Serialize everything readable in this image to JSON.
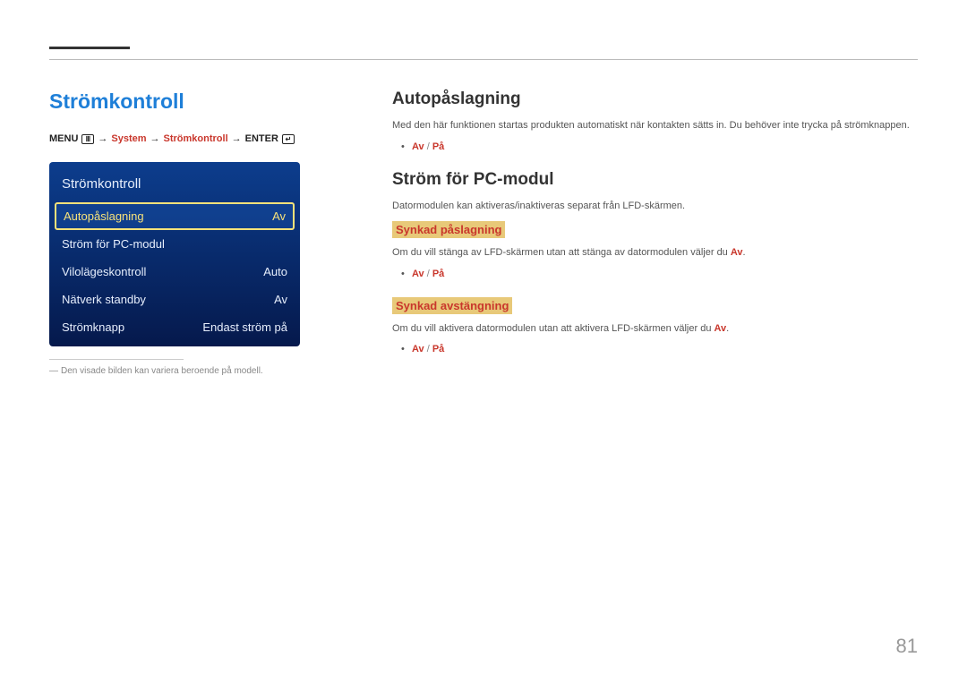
{
  "page_number": "81",
  "left": {
    "title": "Strömkontroll",
    "breadcrumb": {
      "menu": "MENU",
      "arrow": "→",
      "system": "System",
      "stromkontroll": "Strömkontroll",
      "enter": "ENTER"
    },
    "menu": {
      "title": "Strömkontroll",
      "rows": [
        {
          "label": "Autopåslagning",
          "value": "Av"
        },
        {
          "label": "Ström för PC-modul",
          "value": ""
        },
        {
          "label": "Vilolägeskontroll",
          "value": "Auto"
        },
        {
          "label": "Nätverk standby",
          "value": "Av"
        },
        {
          "label": "Strömknapp",
          "value": "Endast ström på"
        }
      ]
    },
    "footnote_dash": "―",
    "footnote": "Den visade bilden kan variera beroende på modell."
  },
  "right": {
    "section1": {
      "heading": "Autopåslagning",
      "text": "Med den här funktionen startas produkten automatiskt när kontakten sätts in. Du behöver inte trycka på strömknappen.",
      "options_av": "Av",
      "options_sep": " / ",
      "options_pa": "På"
    },
    "section2": {
      "heading": "Ström för PC-modul",
      "text": "Datormodulen kan aktiveras/inaktiveras separat från LFD-skärmen.",
      "sub1": {
        "heading": "Synkad påslagning",
        "text_pre": "Om du vill stänga av LFD-skärmen utan att stänga av datormodulen väljer du ",
        "text_av": "Av",
        "text_post": ".",
        "options_av": "Av",
        "options_sep": " / ",
        "options_pa": "På"
      },
      "sub2": {
        "heading": "Synkad avstängning",
        "text_pre": "Om du vill aktivera datormodulen utan att aktivera LFD-skärmen väljer du ",
        "text_av": "Av",
        "text_post": ".",
        "options_av": "Av",
        "options_sep": " / ",
        "options_pa": "På"
      }
    }
  }
}
